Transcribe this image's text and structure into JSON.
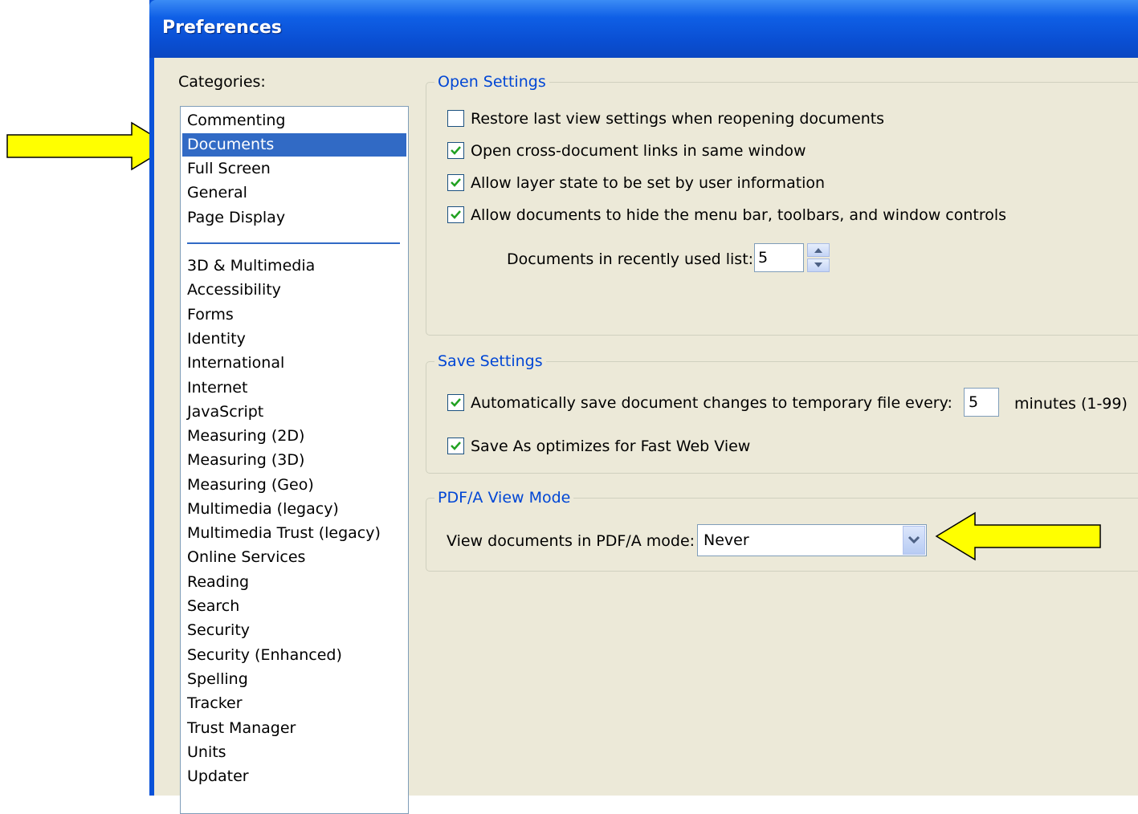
{
  "window": {
    "title": "Preferences"
  },
  "categories": {
    "label": "Categories:",
    "top_items": [
      {
        "label": "Commenting"
      },
      {
        "label": "Documents",
        "selected": true
      },
      {
        "label": "Full Screen"
      },
      {
        "label": "General"
      },
      {
        "label": "Page Display"
      }
    ],
    "items": [
      {
        "label": "3D & Multimedia"
      },
      {
        "label": "Accessibility"
      },
      {
        "label": "Forms"
      },
      {
        "label": "Identity"
      },
      {
        "label": "International"
      },
      {
        "label": "Internet"
      },
      {
        "label": "JavaScript"
      },
      {
        "label": "Measuring (2D)"
      },
      {
        "label": "Measuring (3D)"
      },
      {
        "label": "Measuring (Geo)"
      },
      {
        "label": "Multimedia (legacy)"
      },
      {
        "label": "Multimedia Trust (legacy)"
      },
      {
        "label": "Online Services"
      },
      {
        "label": "Reading"
      },
      {
        "label": "Search"
      },
      {
        "label": "Security"
      },
      {
        "label": "Security (Enhanced)"
      },
      {
        "label": "Spelling"
      },
      {
        "label": "Tracker"
      },
      {
        "label": "Trust Manager"
      },
      {
        "label": "Units"
      },
      {
        "label": "Updater"
      }
    ]
  },
  "open_settings": {
    "legend": "Open Settings",
    "options": [
      {
        "label": "Restore last view settings when reopening documents",
        "checked": false
      },
      {
        "label": "Open cross-document links in same window",
        "checked": true
      },
      {
        "label": "Allow layer state to be set by user information",
        "checked": true
      },
      {
        "label": "Allow documents to hide the menu bar, toolbars, and window controls",
        "checked": true
      }
    ],
    "recent_label": "Documents in recently used list:",
    "recent_value": "5"
  },
  "save_settings": {
    "legend": "Save Settings",
    "autosave_label": "Automatically save document changes to temporary file every:",
    "autosave_checked": true,
    "autosave_value": "5",
    "autosave_unit": "minutes (1-99)",
    "fast_web_label": "Save As optimizes for Fast Web View",
    "fast_web_checked": true
  },
  "pdfa": {
    "legend": "PDF/A View Mode",
    "label": "View documents in PDF/A mode:",
    "value": "Never"
  },
  "colors": {
    "accent_arrow": "#ffff00",
    "selection": "#316ac5",
    "legend_text": "#0046d5",
    "check": "#21a121"
  }
}
